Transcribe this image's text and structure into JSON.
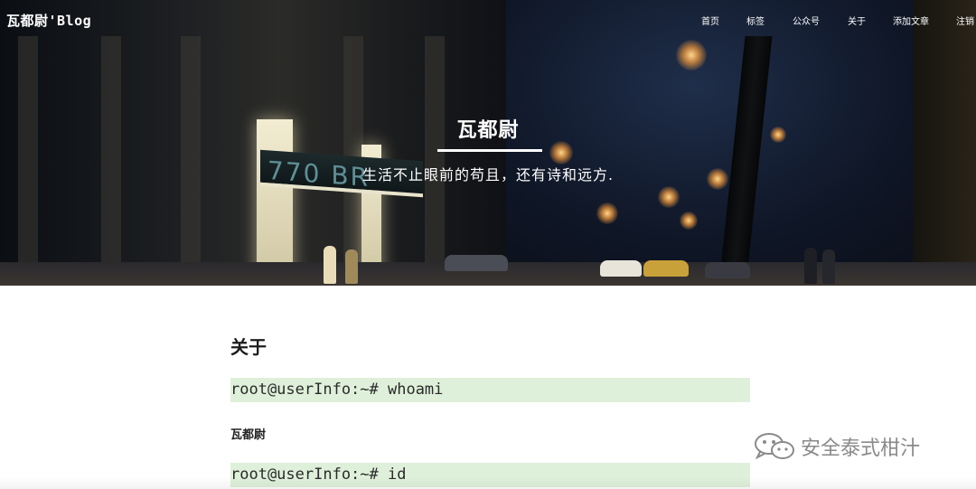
{
  "brand": "瓦都尉'Blog",
  "nav": [
    {
      "label": "首页",
      "name": "nav-home"
    },
    {
      "label": "标签",
      "name": "nav-tags"
    },
    {
      "label": "公众号",
      "name": "nav-wechat"
    },
    {
      "label": "关于",
      "name": "nav-about"
    },
    {
      "label": "添加文章",
      "name": "nav-add-article"
    },
    {
      "label": "注销",
      "name": "nav-logout"
    }
  ],
  "hero": {
    "title": "瓦都尉",
    "subtitle": "生活不止眼前的苟且，还有诗和远方.",
    "sign_text": "770 BR"
  },
  "content": {
    "heading": "关于",
    "code1": "root@userInfo:~# whoami",
    "output1": "瓦都尉",
    "code2": "root@userInfo:~# id"
  },
  "watermark": {
    "text": "安全泰式柑汁",
    "icon": "wechat-icon"
  },
  "colors": {
    "code_bg": "#dff0da",
    "nav_text": "#ffffff",
    "watermark": "#8a8a8a"
  }
}
